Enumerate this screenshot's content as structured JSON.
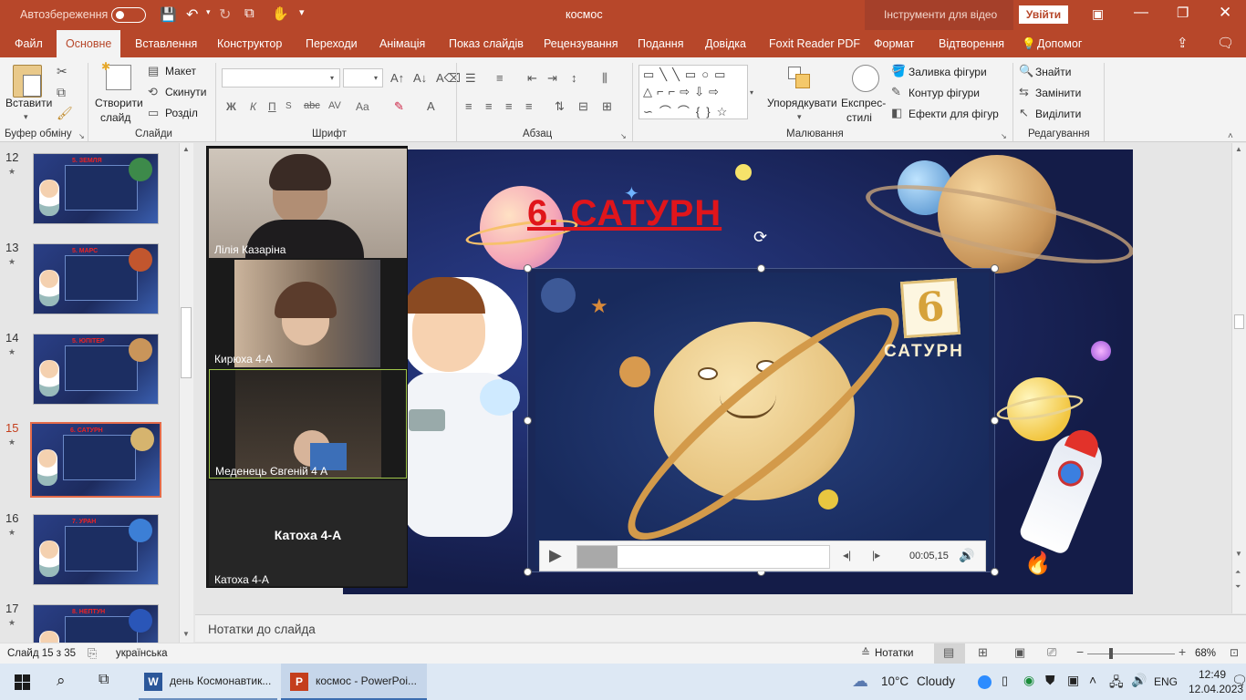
{
  "titlebar": {
    "autosave_label": "Автозбереження",
    "doc_title": "космос",
    "video_tools": "Інструменти для відео",
    "signin_button": "Увійти"
  },
  "tabs": [
    "Файл",
    "Основне",
    "Вставлення",
    "Конструктор",
    "Переходи",
    "Анімація",
    "Показ слайдів",
    "Рецензування",
    "Подання",
    "Довідка",
    "Foxit Reader PDF",
    "Формат",
    "Відтворення",
    "Допомог"
  ],
  "ribbon": {
    "clipboard": {
      "paste": "Вставити",
      "label": "Буфер обміну"
    },
    "slides": {
      "new_slide_1": "Створити",
      "new_slide_2": "слайд",
      "layout": "Макет",
      "reset": "Скинути",
      "section": "Розділ",
      "label": "Слайди"
    },
    "font": {
      "bold": "Ж",
      "italic": "К",
      "underline": "П",
      "strike": "abc",
      "spacing": "AV",
      "case": "Aa",
      "label": "Шрифт"
    },
    "paragraph": {
      "label": "Абзац"
    },
    "drawing": {
      "arrange": "Упорядкувати",
      "quick_styles_1": "Експрес-",
      "quick_styles_2": "стилі",
      "fill": "Заливка фігури",
      "outline": "Контур фігури",
      "effects": "Ефекти для фігур",
      "label": "Малювання"
    },
    "editing": {
      "find": "Знайти",
      "replace": "Замінити",
      "select": "Виділити",
      "label": "Редагування"
    }
  },
  "thumbnails": [
    {
      "num": "12",
      "title": "5. ЗЕМЛЯ",
      "planet_color": "#3d8a4a"
    },
    {
      "num": "13",
      "title": "5. МАРС",
      "planet_color": "#c2562e"
    },
    {
      "num": "14",
      "title": "5. ЮПІТЕР",
      "planet_color": "#c9955a"
    },
    {
      "num": "15",
      "title": "6. САТУРН",
      "planet_color": "#d6b46e"
    },
    {
      "num": "16",
      "title": "7. УРАН",
      "planet_color": "#3c7fd6"
    },
    {
      "num": "17",
      "title": "8. НЕПТУН",
      "planet_color": "#2a56b8"
    }
  ],
  "zoom": {
    "participants": [
      {
        "name": "Лілія Казаріна"
      },
      {
        "name": "Кирюха 4-А"
      },
      {
        "name": "Меденець Євгеній 4 А"
      },
      {
        "name": "Катоха 4-А",
        "center_label": "Катоха 4-А"
      }
    ]
  },
  "slide": {
    "title": "6. САТУРН",
    "video_badge_number": "6",
    "video_badge_text": "САТУРН",
    "video_time": "00:05,15",
    "video_progress": 0.16
  },
  "notes_placeholder": "Нотатки до слайда",
  "status": {
    "slide_info": "Слайд 15 з 35",
    "language": "українська",
    "notes_button": "Нотатки",
    "zoom_level": "68%"
  },
  "taskbar": {
    "app1": "день Космонавтик...",
    "app2": "космос - PowerPoi...",
    "weather_temp": "10°C",
    "weather_desc": "Cloudy",
    "lang": "ENG",
    "time": "12:49",
    "date": "12.04.2023"
  },
  "colors": {
    "accent": "#b7472a",
    "slide_title": "#e0151b",
    "tab_active_text": "#b7472a"
  }
}
